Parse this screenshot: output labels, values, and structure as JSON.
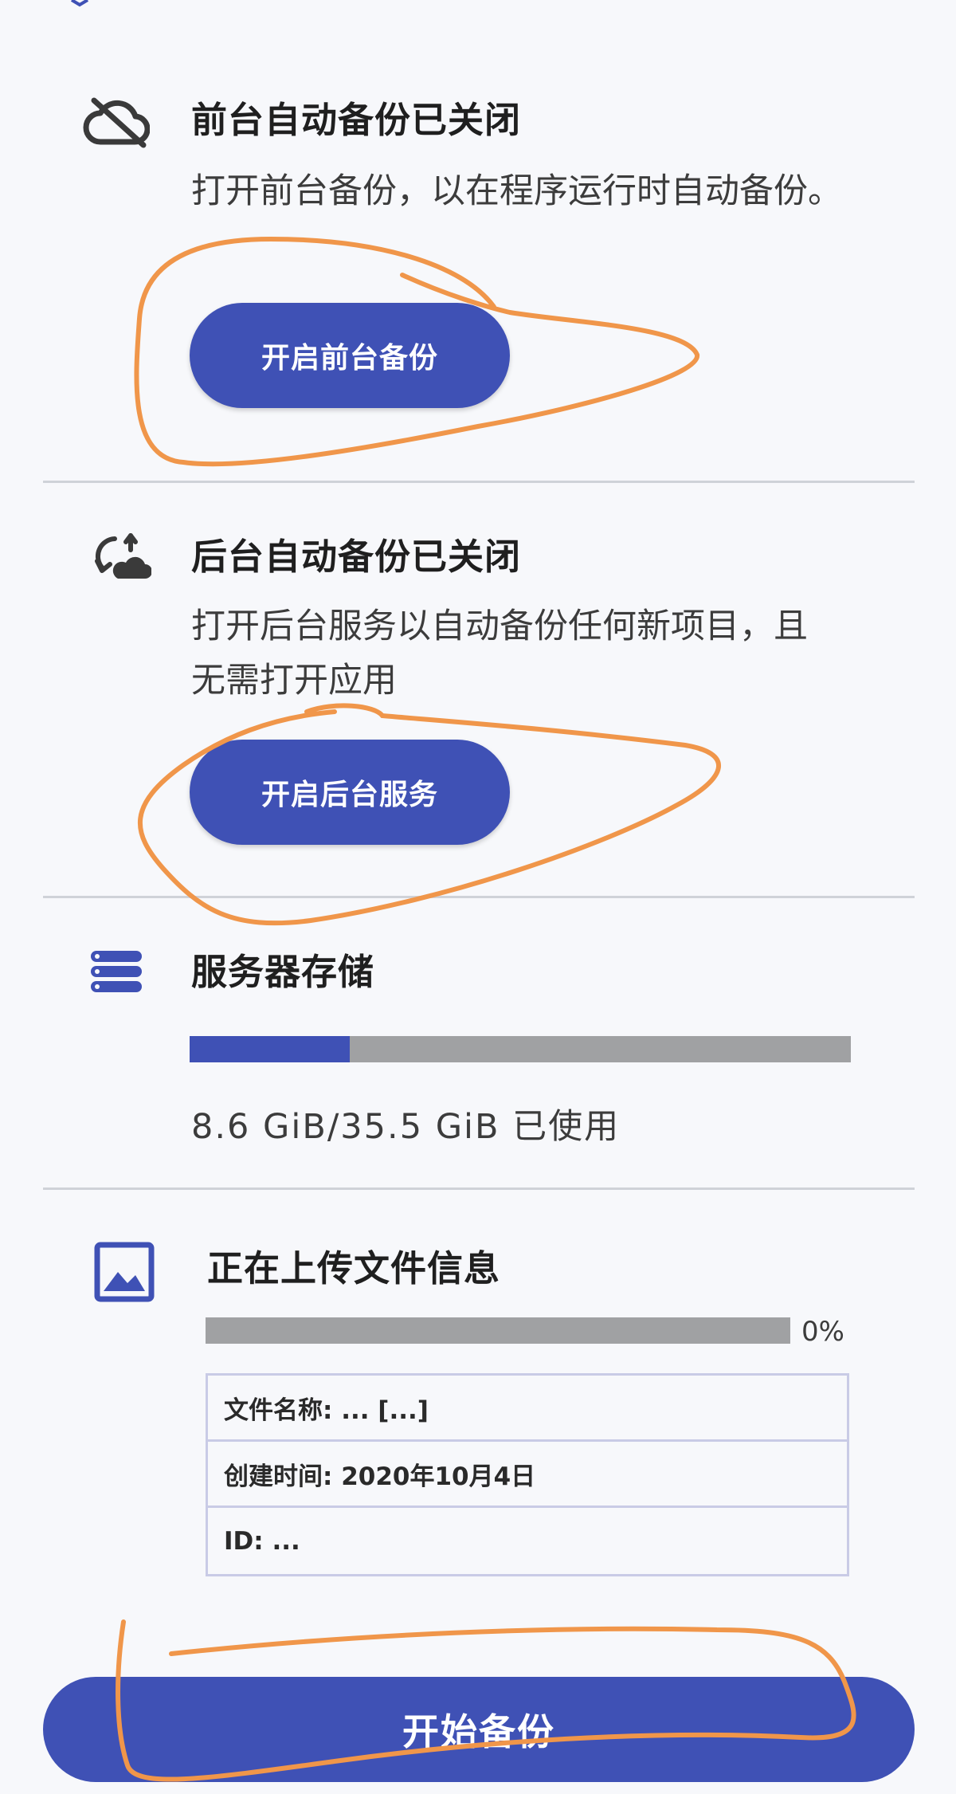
{
  "foreground": {
    "icon": "cloud-off-icon",
    "title": "前台自动备份已关闭",
    "description": "打开前台备份，以在程序运行时自动备份。",
    "button_label": "开启前台备份"
  },
  "background": {
    "icon": "cloud-sync-icon",
    "title": "后台自动备份已关闭",
    "description": "打开后台服务以自动备份任何新项目，且无需打开应用",
    "button_label": "开启后台服务"
  },
  "storage": {
    "icon": "server-icon",
    "title": "服务器存储",
    "used_fraction": 0.242,
    "usage_text": "8.6 GiB/35.5 GiB 已使用"
  },
  "upload": {
    "icon": "image-icon",
    "title": "正在上传文件信息",
    "progress_fraction": 0,
    "percent_text": "0%",
    "rows": [
      {
        "text": "文件名称: ... [...]"
      },
      {
        "text": "创建时间: 2020年10月4日"
      },
      {
        "text": "ID: ..."
      }
    ]
  },
  "footer": {
    "start_button_label": "开始备份"
  },
  "colors": {
    "accent": "#3f51b5",
    "annotation": "#f0964a",
    "track": "#a0a1a3"
  }
}
